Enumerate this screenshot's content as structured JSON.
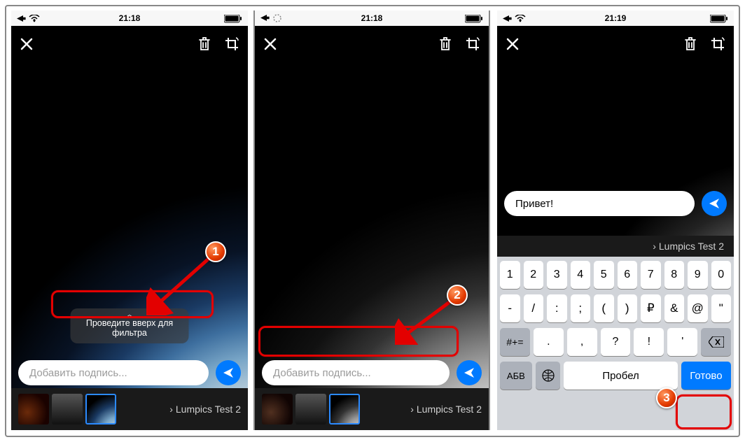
{
  "status": {
    "time_a": "21:18",
    "time_b": "21:18",
    "time_c": "21:19"
  },
  "editor": {
    "filter_hint": "Проведите вверх для фильтра",
    "caption_placeholder": "Добавить подпись...",
    "caption_value": "Привет!",
    "recipient": "Lumpics Test 2"
  },
  "keyboard": {
    "row1": [
      "1",
      "2",
      "3",
      "4",
      "5",
      "6",
      "7",
      "8",
      "9",
      "0"
    ],
    "row2": [
      "-",
      "/",
      ":",
      ";",
      "(",
      ")",
      "₽",
      "&",
      "@",
      "\""
    ],
    "row3_left": "#+=",
    "row3": [
      ".",
      ",",
      "?",
      "!",
      "'"
    ],
    "row4_abc": "АБВ",
    "row4_space": "Пробел",
    "row4_done": "Готово"
  },
  "steps": {
    "s1": "1",
    "s2": "2",
    "s3": "3"
  }
}
